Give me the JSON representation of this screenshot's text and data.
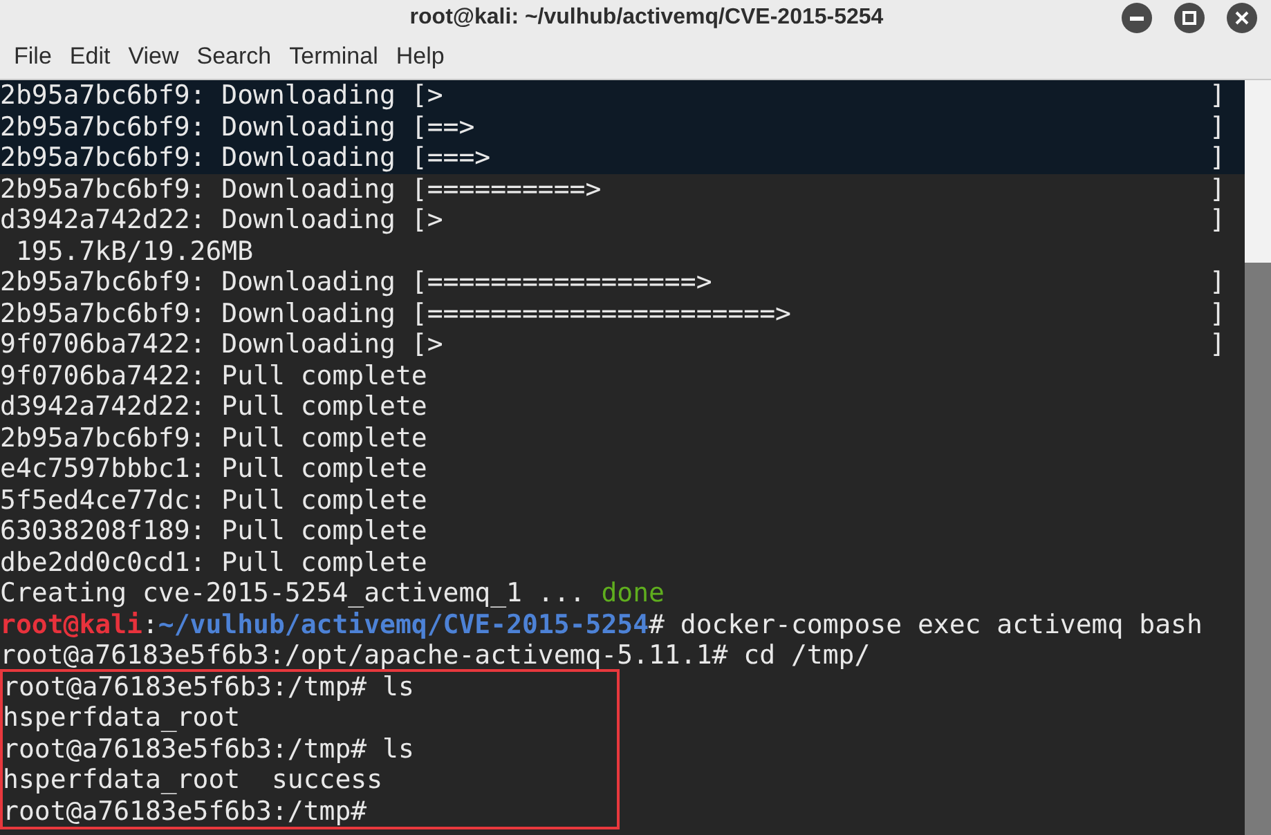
{
  "window": {
    "title": "root@kali: ~/vulhub/activemq/CVE-2015-5254"
  },
  "menu": [
    "File",
    "Edit",
    "View",
    "Search",
    "Terminal",
    "Help"
  ],
  "lines": [
    {
      "segments": [
        {
          "kind": "plain",
          "text": "2b95a7bc6bf9: Downloading [>"
        }
      ],
      "end": "]",
      "highlighted": false
    },
    {
      "segments": [
        {
          "kind": "plain",
          "text": "2b95a7bc6bf9: Downloading [==>"
        }
      ],
      "end": "]",
      "highlighted": false
    },
    {
      "segments": [
        {
          "kind": "plain",
          "text": "2b95a7bc6bf9: Downloading [===>"
        }
      ],
      "end": "]",
      "highlighted": false
    },
    {
      "segments": [
        {
          "kind": "plain",
          "text": "2b95a7bc6bf9: Downloading [==========>"
        }
      ],
      "end": "]",
      "highlighted": false
    },
    {
      "segments": [
        {
          "kind": "plain",
          "text": "d3942a742d22: Downloading [>"
        }
      ],
      "end": "]",
      "highlighted": false
    },
    {
      "segments": [
        {
          "kind": "plain",
          "text": " 195.7kB/19.26MB"
        }
      ],
      "highlighted": false
    },
    {
      "segments": [
        {
          "kind": "plain",
          "text": "2b95a7bc6bf9: Downloading [=================>"
        }
      ],
      "end": "]",
      "highlighted": false
    },
    {
      "segments": [
        {
          "kind": "plain",
          "text": "2b95a7bc6bf9: Downloading [======================>"
        }
      ],
      "end": "]",
      "highlighted": false
    },
    {
      "segments": [
        {
          "kind": "plain",
          "text": "9f0706ba7422: Downloading [>"
        }
      ],
      "end": "]",
      "highlighted": false
    },
    {
      "segments": [
        {
          "kind": "plain",
          "text": "9f0706ba7422: Pull complete"
        }
      ],
      "highlighted": false
    },
    {
      "segments": [
        {
          "kind": "plain",
          "text": "d3942a742d22: Pull complete"
        }
      ],
      "highlighted": false
    },
    {
      "segments": [
        {
          "kind": "plain",
          "text": "2b95a7bc6bf9: Pull complete"
        }
      ],
      "highlighted": false
    },
    {
      "segments": [
        {
          "kind": "plain",
          "text": "e4c7597bbbc1: Pull complete"
        }
      ],
      "highlighted": false
    },
    {
      "segments": [
        {
          "kind": "plain",
          "text": "5f5ed4ce77dc: Pull complete"
        }
      ],
      "highlighted": false
    },
    {
      "segments": [
        {
          "kind": "plain",
          "text": "63038208f189: Pull complete"
        }
      ],
      "highlighted": false
    },
    {
      "segments": [
        {
          "kind": "plain",
          "text": "dbe2dd0c0cd1: Pull complete"
        }
      ],
      "highlighted": false
    },
    {
      "segments": [
        {
          "kind": "plain",
          "text": "Creating cve-2015-5254_activemq_1 ... "
        },
        {
          "kind": "ok",
          "text": "done"
        }
      ],
      "highlighted": false
    },
    {
      "segments": [
        {
          "kind": "user",
          "text": "root@kali"
        },
        {
          "kind": "plain",
          "text": ":"
        },
        {
          "kind": "path",
          "text": "~/vulhub/activemq/CVE-2015-5254"
        },
        {
          "kind": "plain",
          "text": "# docker-compose exec activemq bash"
        }
      ],
      "highlighted": false
    },
    {
      "segments": [
        {
          "kind": "plain",
          "text": "root@a76183e5f6b3:/opt/apache-activemq-5.11.1# cd /tmp/"
        }
      ],
      "highlighted": false
    },
    {
      "segments": [
        {
          "kind": "plain",
          "text": "root@a76183e5f6b3:/tmp# ls"
        }
      ],
      "highlighted": true
    },
    {
      "segments": [
        {
          "kind": "plain",
          "text": "hsperfdata_root"
        }
      ],
      "highlighted": true
    },
    {
      "segments": [
        {
          "kind": "plain",
          "text": "root@a76183e5f6b3:/tmp# ls"
        }
      ],
      "highlighted": true
    },
    {
      "segments": [
        {
          "kind": "plain",
          "text": "hsperfdata_root  success"
        }
      ],
      "highlighted": true
    },
    {
      "segments": [
        {
          "kind": "plain",
          "text": "root@a76183e5f6b3:/tmp#"
        }
      ],
      "highlighted": true
    }
  ]
}
